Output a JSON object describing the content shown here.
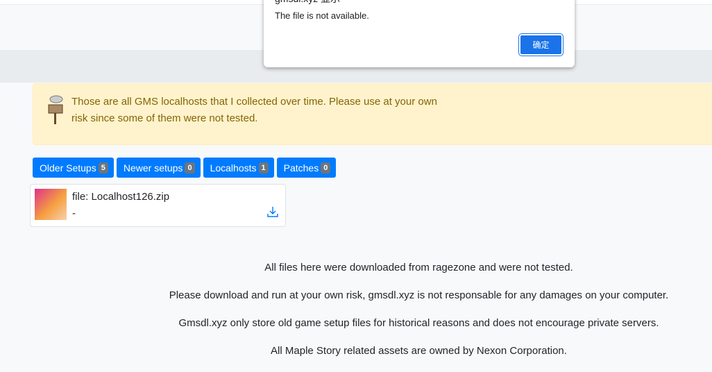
{
  "alert": {
    "text": "Those are all GMS localhosts that I collected over time. Please use at your own risk since some of them were not tested.",
    "icon": "signpost-icon"
  },
  "tabs": [
    {
      "label": "Older Setups",
      "count": "5"
    },
    {
      "label": "Newer setups",
      "count": "0"
    },
    {
      "label": "Localhosts",
      "count": "1"
    },
    {
      "label": "Patches",
      "count": "0"
    }
  ],
  "file": {
    "name": "file: Localhost126.zip",
    "description": "-",
    "icon": "download-icon"
  },
  "footer": [
    "All files here were downloaded from ragezone and were not tested.",
    "Please download and run at your own risk, gmsdl.xyz is not responsable for any damages on your computer.",
    "Gmsdl.xyz only store old game setup files for historical reasons and does not encourage private servers.",
    "All Maple Story related assets are owned by Nexon Corporation."
  ],
  "dialog": {
    "title": "gmsdl.xyz 显示",
    "message": "The file is not available.",
    "ok": "确定"
  },
  "colors": {
    "primary": "#007bff",
    "alert_bg": "#fff3cd",
    "alert_text": "#856404",
    "dialog_button": "#1a73e8"
  }
}
